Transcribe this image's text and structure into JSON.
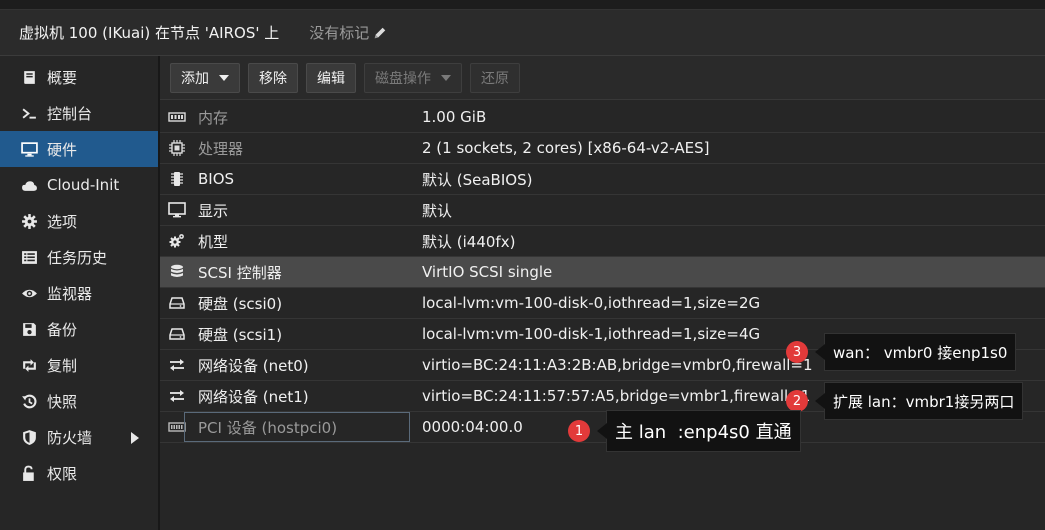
{
  "window": {
    "title": "虚拟机 100 (IKuai) 在节点 'AIROS' 上",
    "tags_label": "没有标记"
  },
  "sidebar": {
    "items": [
      {
        "label": "概要",
        "icon": "book-icon"
      },
      {
        "label": "控制台",
        "icon": "terminal-icon"
      },
      {
        "label": "硬件",
        "icon": "monitor-icon",
        "active": true
      },
      {
        "label": "Cloud-Init",
        "icon": "cloud-icon"
      },
      {
        "label": "选项",
        "icon": "gear-icon"
      },
      {
        "label": "任务历史",
        "icon": "list-icon"
      },
      {
        "label": "监视器",
        "icon": "eye-icon"
      },
      {
        "label": "备份",
        "icon": "floppy-icon"
      },
      {
        "label": "复制",
        "icon": "retweet-icon"
      },
      {
        "label": "快照",
        "icon": "history-icon"
      },
      {
        "label": "防火墙",
        "icon": "shield-icon",
        "has_submenu": true
      },
      {
        "label": "权限",
        "icon": "unlock-icon"
      }
    ]
  },
  "toolbar": {
    "add": "添加",
    "remove": "移除",
    "edit": "编辑",
    "disk_action": "磁盘操作",
    "revert": "还原"
  },
  "hardware": {
    "rows": [
      {
        "icon": "memory-icon",
        "name": "内存",
        "value": "1.00 GiB",
        "dimmed": true
      },
      {
        "icon": "cpu-icon",
        "name": "处理器",
        "value": "2 (1 sockets, 2 cores) [x86-64-v2-AES]",
        "dimmed": true
      },
      {
        "icon": "bios-icon",
        "name": "BIOS",
        "value": "默认 (SeaBIOS)"
      },
      {
        "icon": "display-icon",
        "name": "显示",
        "value": "默认"
      },
      {
        "icon": "cogs-icon",
        "name": "机型",
        "value": "默认 (i440fx)"
      },
      {
        "icon": "database-icon",
        "name": "SCSI 控制器",
        "value": "VirtIO SCSI single",
        "selected": true
      },
      {
        "icon": "hdd-icon",
        "name": "硬盘 (scsi0)",
        "value": "local-lvm:vm-100-disk-0,iothread=1,size=2G"
      },
      {
        "icon": "hdd-icon",
        "name": "硬盘 (scsi1)",
        "value": "local-lvm:vm-100-disk-1,iothread=1,size=4G"
      },
      {
        "icon": "exchange-icon",
        "name": "网络设备 (net0)",
        "value": "virtio=BC:24:11:A3:2B:AB,bridge=vmbr0,firewall=1"
      },
      {
        "icon": "exchange-icon",
        "name": "网络设备 (net1)",
        "value": "virtio=BC:24:11:57:57:A5,bridge=vmbr1,firewall=1"
      },
      {
        "icon": "pci-icon",
        "name": "PCI 设备 (hostpci0)",
        "value": "0000:04:00.0",
        "dimmed": true,
        "focused": true
      }
    ]
  },
  "annotations": [
    {
      "num": "3",
      "text": "wan： vmbr0 接enp1s0"
    },
    {
      "num": "2",
      "text": "扩展 lan：vmbr1接另两口"
    },
    {
      "num": "1",
      "text": "主 lan  :enp4s0 直通"
    }
  ],
  "colors": {
    "accent": "#215a8e",
    "badge": "#e23a3a"
  }
}
